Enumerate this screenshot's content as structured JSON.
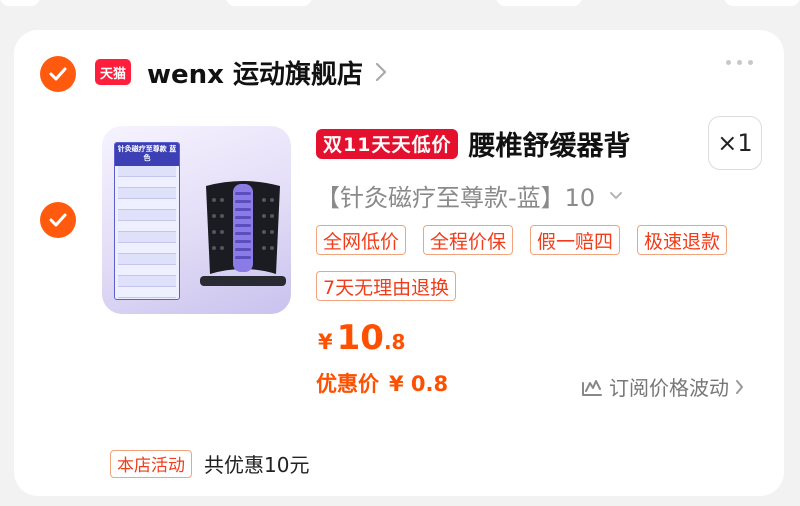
{
  "store": {
    "platform_logo": "天猫",
    "name": "wenx 运动旗舰店"
  },
  "product": {
    "promo_badge": "双11天天低价",
    "title": "腰椎舒缓器背",
    "quantity": "×1",
    "sku": "【针灸磁疗至尊款-蓝】10",
    "image": {
      "header": "针灸磁疗至尊款 蓝色"
    },
    "tags": [
      "全网低价",
      "全程价保",
      "假一赔四",
      "极速退款",
      "7天无理由退换"
    ],
    "price": {
      "symbol": "¥",
      "integer": "10",
      "decimal": ".8"
    },
    "discount": {
      "label": "优惠价",
      "value": "¥ 0.8"
    },
    "subscribe_label": "订阅价格波动"
  },
  "activity": {
    "tag": "本店活动",
    "text": "共优惠10元"
  },
  "colors": {
    "accent": "#ff5000",
    "check": "#ff5a0d",
    "tmall_red": "#ff1f3d",
    "promo_red": "#e4102e"
  },
  "icons": [
    "check-icon",
    "chevron-right-icon",
    "more-icon",
    "chevron-down-icon",
    "price-subscribe-icon"
  ]
}
